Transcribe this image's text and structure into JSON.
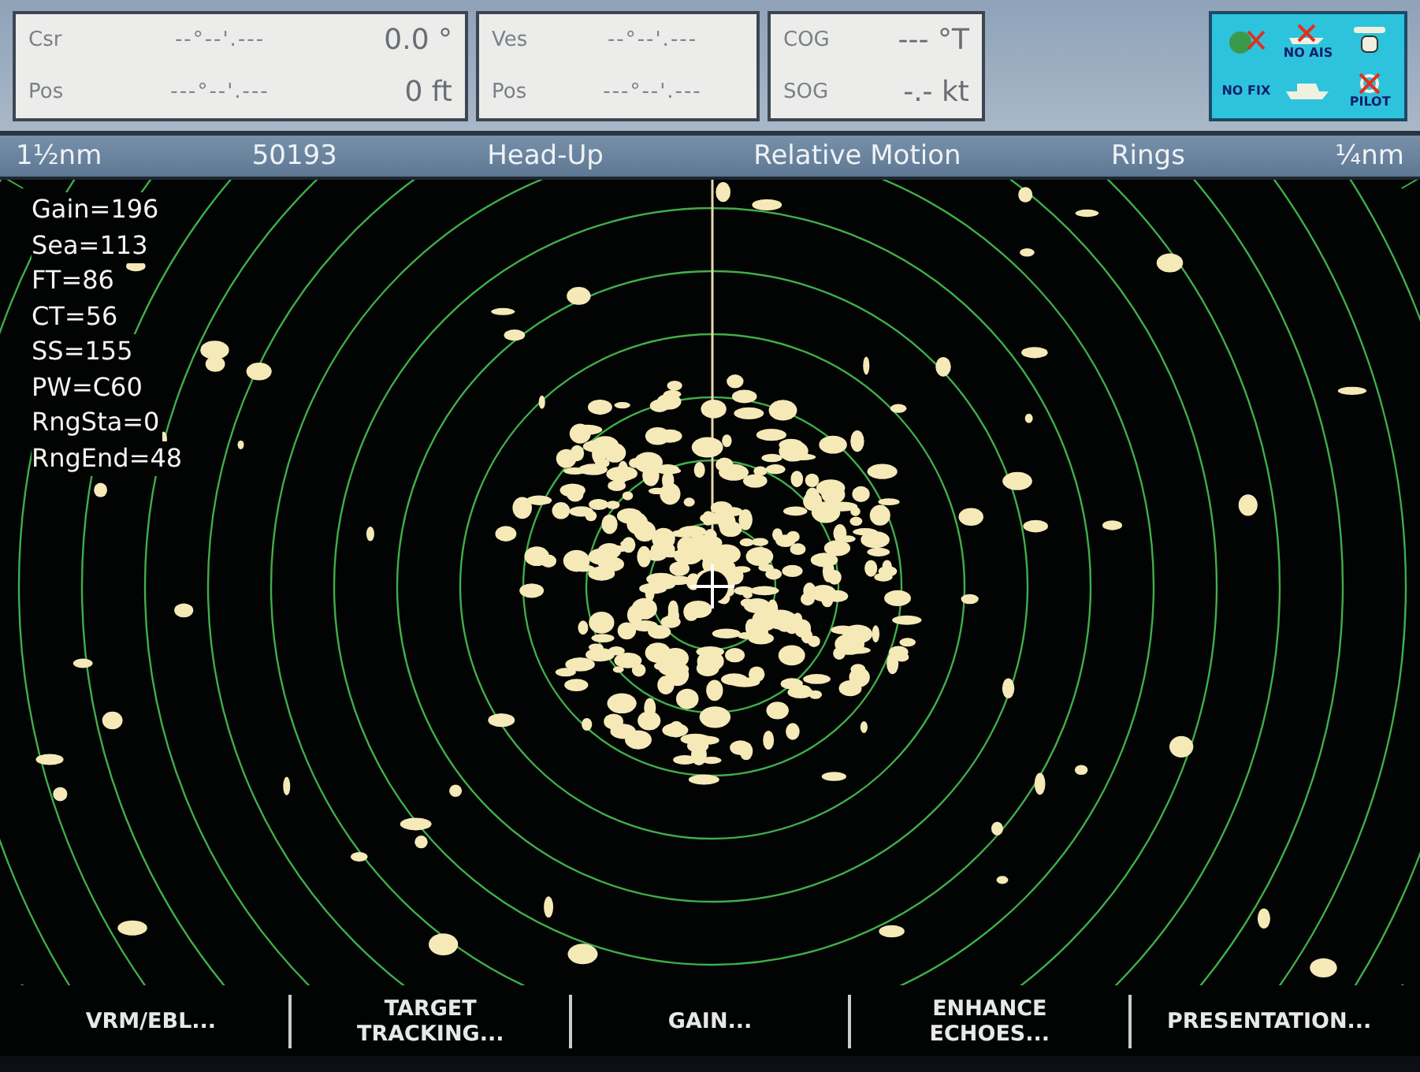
{
  "data_panels": [
    {
      "rows": [
        {
          "label": "Csr",
          "value": "--°--'.---",
          "reading": "0.0 °"
        },
        {
          "label": "Pos",
          "value": "---°--'.---",
          "reading": "0 ft"
        }
      ]
    },
    {
      "rows": [
        {
          "label": "Ves",
          "value": "--°--'.---"
        },
        {
          "label": "Pos",
          "value": "---°--'.---"
        }
      ]
    },
    {
      "rows": [
        {
          "label": "COG",
          "reading": "--- °T"
        },
        {
          "label": "SOG",
          "reading": "-.- kt"
        }
      ]
    }
  ],
  "status_icons": {
    "fix": "NO FIX",
    "ais": "NO AIS",
    "pilot": "PILOT"
  },
  "status_bar": [
    "1½nm",
    "50193",
    "Head-Up",
    "Relative Motion",
    "Rings",
    "¼nm"
  ],
  "readouts": [
    "Gain=196",
    "Sea=113",
    "FT=86",
    "CT=56",
    "SS=155",
    "PW=C60",
    "RngSta=0",
    "RngEnd=48"
  ],
  "softkeys": [
    {
      "lines": [
        "VRM/EBL..."
      ]
    },
    {
      "lines": [
        "TARGET",
        "TRACKING..."
      ]
    },
    {
      "lines": [
        "GAIN..."
      ]
    },
    {
      "lines": [
        "ENHANCE",
        "ECHOES..."
      ]
    },
    {
      "lines": [
        "PRESENTATION..."
      ]
    }
  ]
}
